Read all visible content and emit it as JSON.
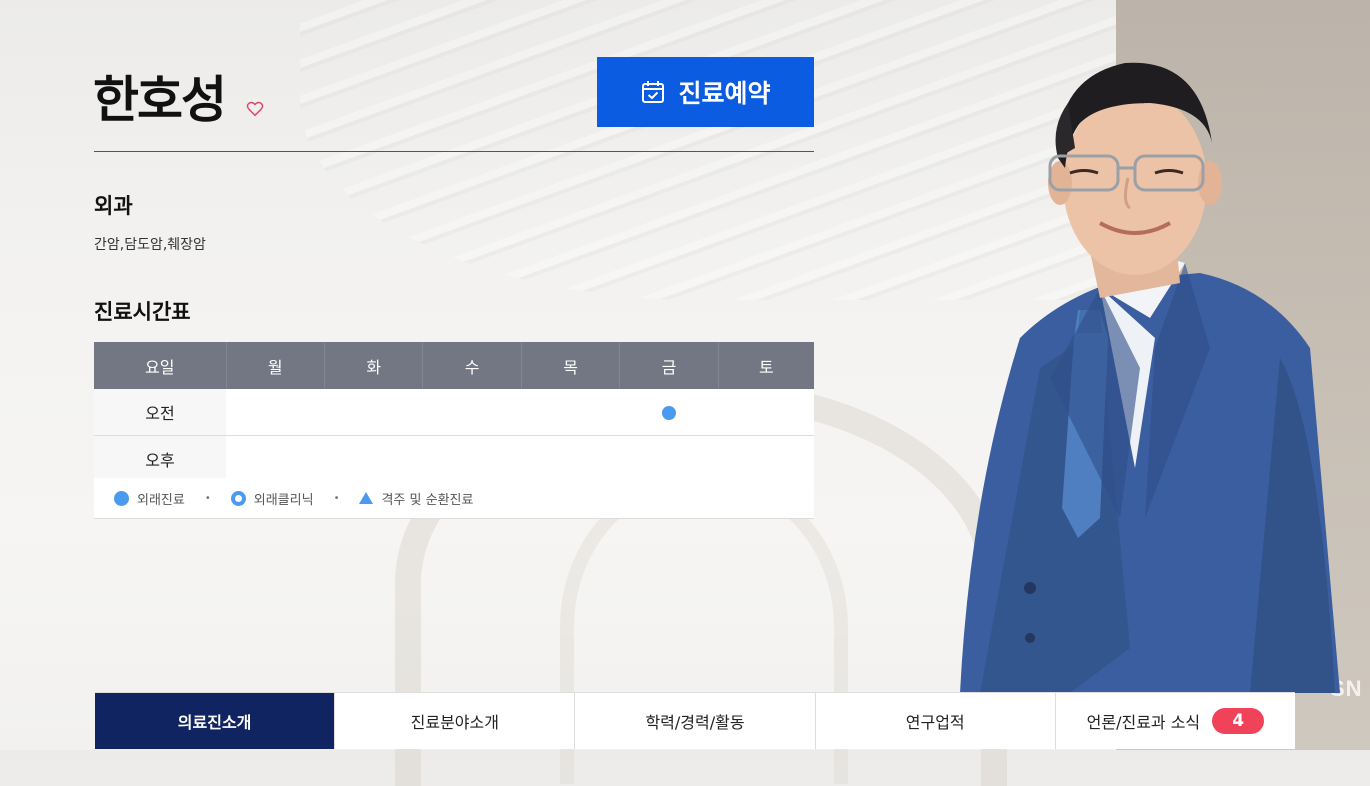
{
  "doctor": {
    "name": "한호성",
    "department": "외과",
    "specialty": "간암,담도암,췌장암"
  },
  "reserve_button": {
    "label": "진료예약",
    "icon": "calendar-check-icon"
  },
  "schedule": {
    "title": "진료시간표",
    "headers": [
      "요일",
      "월",
      "화",
      "수",
      "목",
      "금",
      "토"
    ],
    "rows": [
      {
        "label": "오전",
        "marks": [
          "",
          "",
          "",
          "",
          "outpatient",
          ""
        ]
      },
      {
        "label": "오후",
        "marks": [
          "",
          "",
          "",
          "",
          "",
          ""
        ]
      }
    ],
    "legend": {
      "outpatient": "외래진료",
      "clinic": "외래클리닉",
      "rotation": "격주 및 순환진료",
      "separator": "•"
    },
    "mark_color": "#4a9bf0"
  },
  "tabs": [
    {
      "label": "의료진소개",
      "active": true
    },
    {
      "label": "진료분야소개"
    },
    {
      "label": "학력/경력/활동"
    },
    {
      "label": "연구업적"
    },
    {
      "label": "언론/진료과 소식",
      "badge": "4"
    }
  ],
  "watermark": "SN",
  "colors": {
    "accent": "#0b5ce0",
    "tab_active": "#0f2460",
    "badge": "#f0435a",
    "table_header": "#737783"
  }
}
